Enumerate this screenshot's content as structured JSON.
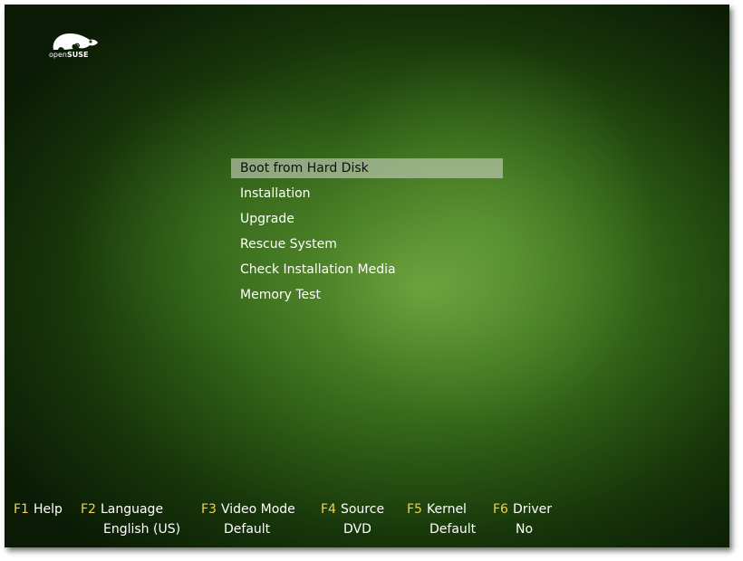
{
  "logo": {
    "icon": "opensuse-chameleon-icon",
    "text_prefix": "open",
    "text_brand": "SUSE"
  },
  "menu": {
    "items": [
      {
        "label": "Boot from Hard Disk",
        "selected": true
      },
      {
        "label": "Installation"
      },
      {
        "label": "Upgrade"
      },
      {
        "label": "Rescue System"
      },
      {
        "label": "Check Installation Media"
      },
      {
        "label": "Memory Test"
      }
    ]
  },
  "function_keys": [
    {
      "key": "F1",
      "label": "Help",
      "value": ""
    },
    {
      "key": "F2",
      "label": "Language",
      "value": "English (US)"
    },
    {
      "key": "F3",
      "label": "Video Mode",
      "value": "Default"
    },
    {
      "key": "F4",
      "label": "Source",
      "value": "DVD"
    },
    {
      "key": "F5",
      "label": "Kernel",
      "value": "Default"
    },
    {
      "key": "F6",
      "label": "Driver",
      "value": "No"
    }
  ],
  "colors": {
    "key_accent": "#f2d24a",
    "selection": "#c8d2be",
    "background_center": "#6a9e3c",
    "background_edge": "#0a1a05"
  }
}
